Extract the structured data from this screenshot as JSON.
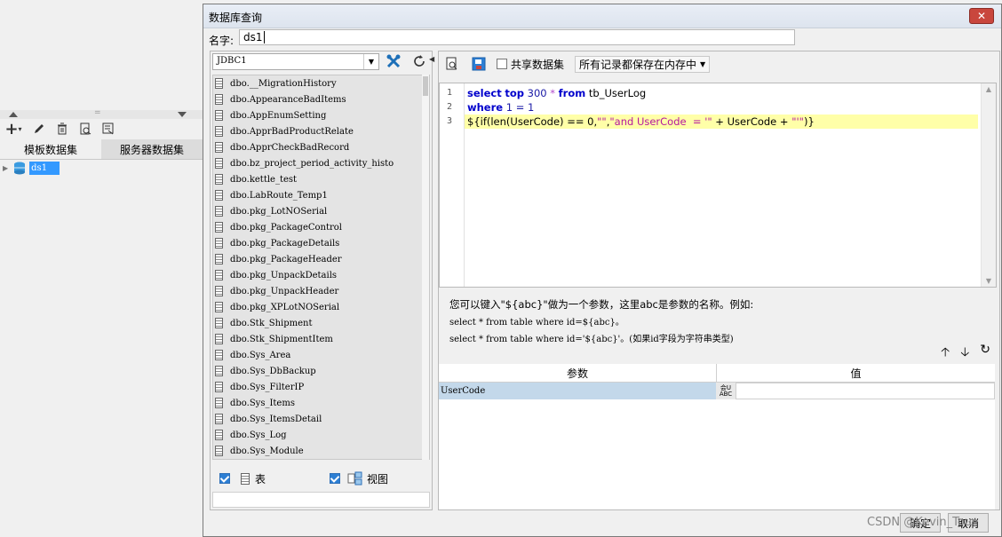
{
  "left_panel": {
    "tabs": [
      "模板数据集",
      "服务器数据集"
    ],
    "tree_item": "ds1"
  },
  "dialog": {
    "title": "数据库查询",
    "close_label": "✕",
    "name_label": "名字:",
    "name_value": "ds1",
    "connection": "JDBC1",
    "tables": [
      "dbo.__MigrationHistory",
      "dbo.AppearanceBadItems",
      "dbo.AppEnumSetting",
      "dbo.ApprBadProductRelate",
      "dbo.ApprCheckBadRecord",
      "dbo.bz_project_period_activity_histo",
      "dbo.kettle_test",
      "dbo.LabRoute_Temp1",
      "dbo.pkg_LotNOSerial",
      "dbo.pkg_PackageControl",
      "dbo.pkg_PackageDetails",
      "dbo.pkg_PackageHeader",
      "dbo.pkg_UnpackDetails",
      "dbo.pkg_UnpackHeader",
      "dbo.pkg_XPLotNOSerial",
      "dbo.Stk_Shipment",
      "dbo.Stk_ShipmentItem",
      "dbo.Sys_Area",
      "dbo.Sys_DbBackup",
      "dbo.Sys_FilterIP",
      "dbo.Sys_Items",
      "dbo.Sys_ItemsDetail",
      "dbo.Sys_Log",
      "dbo.Sys_Module"
    ],
    "filter_table_label": "表",
    "filter_view_label": "视图",
    "share_label": "共享数据集",
    "mode_value": "所有记录都保存在内存中",
    "sql": {
      "line_numbers": [
        "1",
        "2",
        "3"
      ],
      "line1": {
        "select": "select",
        "top": "top",
        "num": "300",
        "star": "*",
        "from": "from",
        "table": " tb_UserLog"
      },
      "line2": {
        "where": "where",
        "rest": " 1 = 1"
      },
      "line3": {
        "a": "${if(len(UserCode) == 0,",
        "s1": "\"\"",
        "c": ",",
        "s2": "\"and UserCode  = '\"",
        "d": " + UserCode + ",
        "s3": "\"'\"",
        "e": ")}"
      }
    },
    "hint": {
      "line1": "您可以键入\"${abc}\"做为一个参数，这里abc是参数的名称。例如:",
      "line2": "select * from table where id=${abc}。",
      "line3": "select * from table where id='${abc}'。(如果id字段为字符串类型)"
    },
    "param_headers": [
      "参数",
      "值"
    ],
    "param_name": "UserCode",
    "param_type_top": "会U",
    "param_type_bottom": "ABC",
    "ok_label": "确定",
    "cancel_label": "取消"
  },
  "watermark": "CSDN @Kevin_Tou"
}
